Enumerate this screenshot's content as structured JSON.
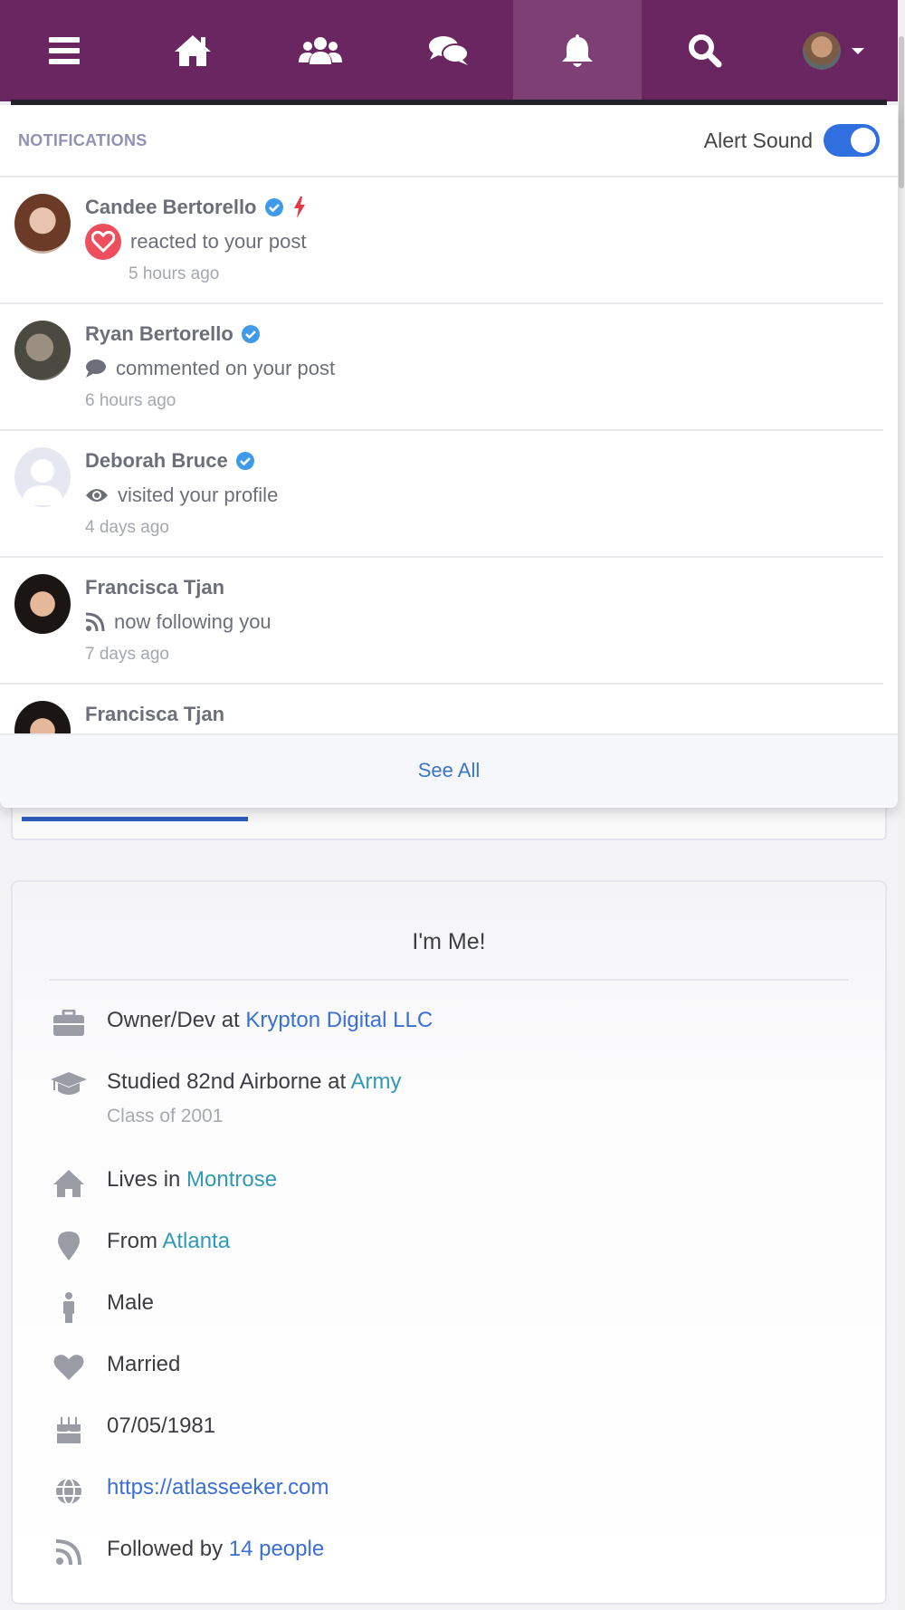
{
  "navbar": {
    "icons": [
      "menu-icon",
      "home-icon",
      "groups-icon",
      "messages-icon",
      "bell-icon",
      "search-icon",
      "user-avatar"
    ],
    "active": "bell-icon",
    "brand_color": "#6a2660"
  },
  "notifications": {
    "title": "NOTIFICATIONS",
    "alert_sound_label": "Alert Sound",
    "alert_sound_on": true,
    "see_all": "See All",
    "items": [
      {
        "name": "Candee Bertorello",
        "verified": true,
        "action_icon": "heart-icon",
        "action": "reacted to your post",
        "time": "5 hours ago"
      },
      {
        "name": "Ryan Bertorello",
        "verified": true,
        "action_icon": "comment-icon",
        "action": "commented on your post",
        "time": "6 hours ago"
      },
      {
        "name": "Deborah Bruce",
        "verified": true,
        "action_icon": "eye-icon",
        "action": "visited your profile",
        "time": "4 days ago"
      },
      {
        "name": "Francisca Tjan",
        "verified": false,
        "action_icon": "rss-icon",
        "action": "now following you",
        "time": "7 days ago"
      },
      {
        "name": "Francisca Tjan",
        "verified": false,
        "action_icon": "",
        "action": "",
        "time": ""
      }
    ]
  },
  "about": {
    "title": "I'm Me!",
    "work": {
      "prefix": "Owner/Dev at ",
      "link": "Krypton Digital LLC"
    },
    "education": {
      "prefix": "Studied 82nd Airborne at ",
      "link": "Army",
      "sub": "Class of 2001"
    },
    "lives": {
      "prefix": "Lives in ",
      "link": "Montrose"
    },
    "from": {
      "prefix": "From ",
      "link": "Atlanta"
    },
    "gender": "Male",
    "relationship": "Married",
    "birthday": "07/05/1981",
    "website": "https://atlasseeker.com",
    "followers": {
      "prefix": "Followed by ",
      "link": "14 people"
    }
  }
}
